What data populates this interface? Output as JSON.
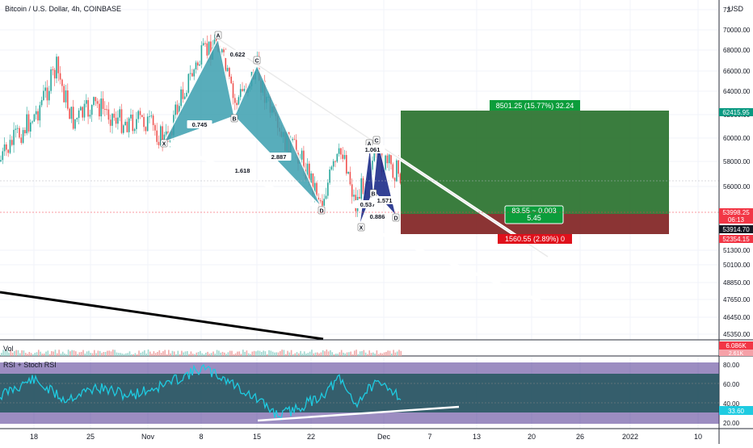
{
  "header": {
    "title": "Bitcoin / U.S. Dollar, 4h, COINBASE",
    "currency": "USD"
  },
  "price_axis": {
    "ticks": [
      "72",
      "70000.00",
      "68000.00",
      "66000.00",
      "64000.00",
      "62000.00",
      "60000.00",
      "58000.00",
      "56000.00",
      "51300.00",
      "50100.00",
      "48850.00",
      "47650.00",
      "46450.00",
      "45350.00"
    ],
    "tags": [
      {
        "text": "62415.95",
        "color": "#089981"
      },
      {
        "text": "53998.25",
        "color": "#f23645"
      },
      {
        "text": "06:13",
        "color": "#f23645"
      },
      {
        "text": "53914.70",
        "color": "#131722"
      },
      {
        "text": "52354.15",
        "color": "#f23645"
      }
    ]
  },
  "time_axis": {
    "labels": [
      "18",
      "25",
      "Nov",
      "8",
      "15",
      "22",
      "Dec",
      "7",
      "13",
      "20",
      "26",
      "2022",
      "10"
    ]
  },
  "harmonic": {
    "points": [
      "X",
      "A",
      "B",
      "C",
      "D",
      "X",
      "A",
      "B",
      "C",
      "D"
    ],
    "ratios": [
      "0.622",
      "0.745",
      "2.887",
      "1.618",
      "1.061",
      "0.537",
      "1.571",
      "0.886"
    ]
  },
  "position": {
    "target_label": "8501.25 (15.77%) 32.24",
    "mid_label_1": "83.55 ~ 0.003",
    "mid_label_2": "5.45",
    "stop_label": "1560.55 (2.89%) 0",
    "colors": {
      "target": "#1f6b23",
      "stop": "#7e1e1e",
      "target_tag": "#0c9d3b",
      "stop_tag": "#e0101b"
    }
  },
  "volume": {
    "label": "Vol",
    "tags": [
      "6.086K",
      "2.61K"
    ]
  },
  "rsi": {
    "label": "RSI + Stoch RSI",
    "ticks": [
      "80.00",
      "60.00",
      "40.00",
      "20.00"
    ],
    "value_tag": "33.60"
  },
  "colors": {
    "pattern_fill": "#3c9fb0",
    "pattern_fill_2": "#1e2d8a",
    "rsi_line": "#1ecbe1",
    "up": "#26a69a",
    "down": "#ef5350"
  }
}
